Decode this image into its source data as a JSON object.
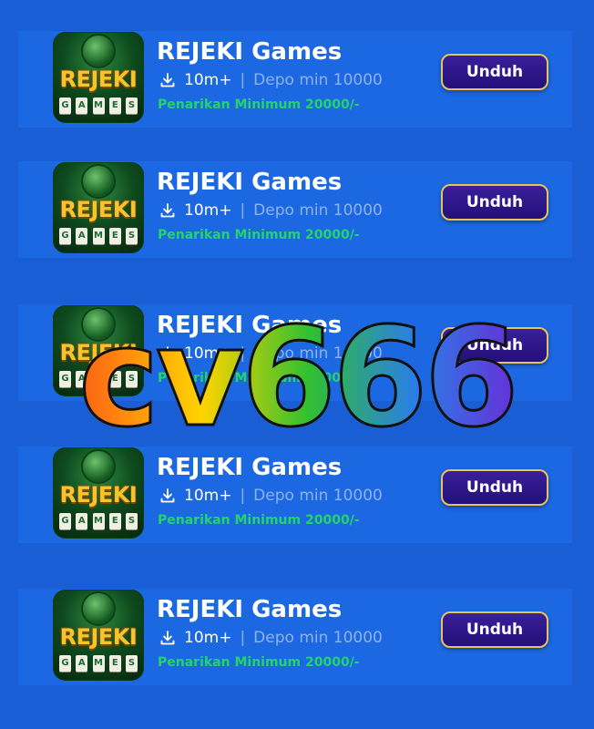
{
  "cards": [
    {
      "title": "REJEKI Games",
      "downloads": "10m+",
      "separator": "|",
      "deposit": "Depo min 10000",
      "withdraw": "Penarikan Minimum 20000/-",
      "button": "Unduh"
    },
    {
      "title": "REJEKI Games",
      "downloads": "10m+",
      "separator": "|",
      "deposit": "Depo min 10000",
      "withdraw": "Penarikan Minimum 20000/-",
      "button": "Unduh"
    },
    {
      "title": "REJEKI Games",
      "downloads": "10m+",
      "separator": "|",
      "deposit": "Depo min 10000",
      "withdraw": "Penarikan Minimum 20000/-",
      "button": "Unduh"
    },
    {
      "title": "REJEKI Games",
      "downloads": "10m+",
      "separator": "|",
      "deposit": "Depo min 10000",
      "withdraw": "Penarikan Minimum 20000/-",
      "button": "Unduh"
    },
    {
      "title": "REJEKI Games",
      "downloads": "10m+",
      "separator": "|",
      "deposit": "Depo min 10000",
      "withdraw": "Penarikan Minimum 20000/-",
      "button": "Unduh"
    }
  ],
  "logo": {
    "word": "REJEKI",
    "tiles": [
      "G",
      "A",
      "M",
      "E",
      "S"
    ]
  },
  "watermark": "cv666",
  "colors": {
    "background": "#1a5ed6",
    "card": "#1c68e3",
    "withdraw_text": "#23d46a",
    "muted_text": "#8fb3ee",
    "button": "#2c1590",
    "button_border": "#e8c25c",
    "logo_gold": "#f4c52e"
  },
  "icons": {
    "download": "download-icon"
  }
}
